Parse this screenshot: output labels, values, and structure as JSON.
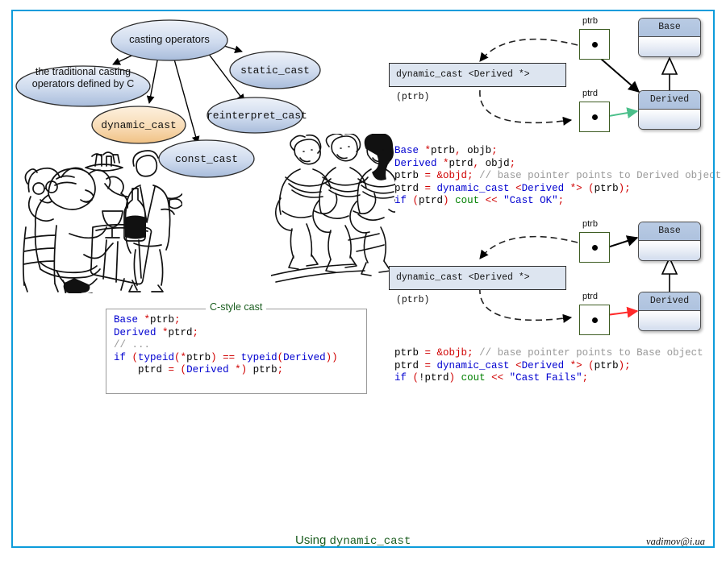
{
  "frame": {
    "border_color": "#0C9CDB"
  },
  "mindmap": {
    "nodes": [
      {
        "id": "root",
        "label": "casting operators",
        "fill": "blue"
      },
      {
        "id": "traditional",
        "label": "the traditional casting\noperators defined by C",
        "fill": "blue"
      },
      {
        "id": "static",
        "label": "static_cast",
        "fill": "blue"
      },
      {
        "id": "reinterpret",
        "label": "reinterpret_cast",
        "fill": "blue"
      },
      {
        "id": "dynamic",
        "label": "dynamic_cast",
        "fill": "orange"
      },
      {
        "id": "const",
        "label": "const_cast",
        "fill": "blue"
      }
    ],
    "edges": [
      {
        "from": "root",
        "to": "traditional"
      },
      {
        "from": "root",
        "to": "static"
      },
      {
        "from": "root",
        "to": "reinterpret"
      },
      {
        "from": "root",
        "to": "dynamic"
      },
      {
        "from": "root",
        "to": "const"
      }
    ],
    "colors": {
      "blue_fill_top": "#e7edf7",
      "blue_fill_bottom": "#aabedd",
      "orange_fill_top": "#fbe3c8",
      "orange_fill_bottom": "#f2c88c"
    }
  },
  "diagram_ok": {
    "expression": "dynamic_cast <Derived *> (ptrb)",
    "ptrb_label": "ptrb",
    "ptrd_label": "ptrd",
    "base_label": "Base",
    "derived_label": "Derived",
    "ptrd_arrow_color": "#4bbf8a",
    "result": "success"
  },
  "diagram_fail": {
    "expression": "dynamic_cast <Derived *> (ptrb)",
    "ptrb_label": "ptrb",
    "ptrd_label": "ptrd",
    "base_label": "Base",
    "derived_label": "Derived",
    "ptrd_arrow_color": "#ff2a2a",
    "result": "failure"
  },
  "code_ok": {
    "lines": [
      [
        {
          "t": "Base ",
          "c": "blue"
        },
        {
          "t": "*",
          "c": "red"
        },
        {
          "t": "ptrb",
          "c": "black"
        },
        {
          "t": ",",
          "c": "red"
        },
        {
          "t": " objb",
          "c": "black"
        },
        {
          "t": ";",
          "c": "red"
        }
      ],
      [
        {
          "t": "Derived ",
          "c": "blue"
        },
        {
          "t": "*",
          "c": "red"
        },
        {
          "t": "ptrd",
          "c": "black"
        },
        {
          "t": ",",
          "c": "red"
        },
        {
          "t": " objd",
          "c": "black"
        },
        {
          "t": ";",
          "c": "red"
        }
      ],
      [
        {
          "t": "ptrb ",
          "c": "black"
        },
        {
          "t": "=",
          "c": "red"
        },
        {
          "t": " ",
          "c": "black"
        },
        {
          "t": "&objd",
          "c": "red"
        },
        {
          "t": ";",
          "c": "red"
        },
        {
          "t": " // base pointer points to Derived object",
          "c": "gray"
        }
      ],
      [
        {
          "t": "ptrd ",
          "c": "black"
        },
        {
          "t": "=",
          "c": "red"
        },
        {
          "t": " dynamic_cast ",
          "c": "blue"
        },
        {
          "t": "<",
          "c": "red"
        },
        {
          "t": "Derived ",
          "c": "blue"
        },
        {
          "t": "*>",
          "c": "red"
        },
        {
          "t": " ",
          "c": "black"
        },
        {
          "t": "(",
          "c": "red"
        },
        {
          "t": "ptrb",
          "c": "black"
        },
        {
          "t": ")",
          "c": "red"
        },
        {
          "t": ";",
          "c": "red"
        }
      ],
      [
        {
          "t": "if ",
          "c": "blue"
        },
        {
          "t": "(",
          "c": "red"
        },
        {
          "t": "ptrd",
          "c": "black"
        },
        {
          "t": ")",
          "c": "red"
        },
        {
          "t": " cout ",
          "c": "green"
        },
        {
          "t": "<<",
          "c": "red"
        },
        {
          "t": " ",
          "c": "black"
        },
        {
          "t": "\"Cast OK\"",
          "c": "str"
        },
        {
          "t": ";",
          "c": "red"
        }
      ]
    ]
  },
  "code_fail": {
    "lines": [
      [
        {
          "t": "ptrb ",
          "c": "black"
        },
        {
          "t": "=",
          "c": "red"
        },
        {
          "t": " ",
          "c": "black"
        },
        {
          "t": "&objb",
          "c": "red"
        },
        {
          "t": ";",
          "c": "red"
        },
        {
          "t": " // base pointer points to Base object",
          "c": "gray"
        }
      ],
      [
        {
          "t": "ptrd ",
          "c": "black"
        },
        {
          "t": "=",
          "c": "red"
        },
        {
          "t": " dynamic_cast ",
          "c": "blue"
        },
        {
          "t": "<",
          "c": "red"
        },
        {
          "t": "Derived ",
          "c": "blue"
        },
        {
          "t": "*>",
          "c": "red"
        },
        {
          "t": " ",
          "c": "black"
        },
        {
          "t": "(",
          "c": "red"
        },
        {
          "t": "ptrb",
          "c": "black"
        },
        {
          "t": ")",
          "c": "red"
        },
        {
          "t": ";",
          "c": "red"
        }
      ],
      [
        {
          "t": "if ",
          "c": "blue"
        },
        {
          "t": "(",
          "c": "red"
        },
        {
          "t": "!ptrd",
          "c": "black"
        },
        {
          "t": ")",
          "c": "red"
        },
        {
          "t": " cout ",
          "c": "green"
        },
        {
          "t": "<<",
          "c": "red"
        },
        {
          "t": " ",
          "c": "black"
        },
        {
          "t": "\"Cast Fails\"",
          "c": "str"
        },
        {
          "t": ";",
          "c": "red"
        }
      ]
    ]
  },
  "cstyle": {
    "title": "C-style cast",
    "title_color": "#1b5e20",
    "lines": [
      [
        {
          "t": "Base ",
          "c": "blue"
        },
        {
          "t": "*",
          "c": "red"
        },
        {
          "t": "ptrb",
          "c": "black"
        },
        {
          "t": ";",
          "c": "red"
        }
      ],
      [
        {
          "t": "Derived ",
          "c": "blue"
        },
        {
          "t": "*",
          "c": "red"
        },
        {
          "t": "ptrd",
          "c": "black"
        },
        {
          "t": ";",
          "c": "red"
        }
      ],
      [
        {
          "t": "// ...",
          "c": "gray"
        }
      ],
      [
        {
          "t": "if ",
          "c": "blue"
        },
        {
          "t": "(",
          "c": "red"
        },
        {
          "t": "typeid",
          "c": "blue"
        },
        {
          "t": "(*",
          "c": "red"
        },
        {
          "t": "ptrb",
          "c": "black"
        },
        {
          "t": ") ",
          "c": "red"
        },
        {
          "t": "==",
          "c": "red"
        },
        {
          "t": " ",
          "c": "black"
        },
        {
          "t": "typeid",
          "c": "blue"
        },
        {
          "t": "(",
          "c": "red"
        },
        {
          "t": "Derived",
          "c": "blue"
        },
        {
          "t": "))",
          "c": "red"
        }
      ],
      [
        {
          "t": "    ptrd ",
          "c": "black"
        },
        {
          "t": "=",
          "c": "red"
        },
        {
          "t": " ",
          "c": "black"
        },
        {
          "t": "(",
          "c": "red"
        },
        {
          "t": "Derived ",
          "c": "blue"
        },
        {
          "t": "*)",
          "c": "red"
        },
        {
          "t": " ptrb",
          "c": "black"
        },
        {
          "t": ";",
          "c": "red"
        }
      ]
    ]
  },
  "cartoons": [
    {
      "id": "diners",
      "alt": "line-art cartoon of people dining at a restaurant table with a waiter"
    },
    {
      "id": "dancers",
      "alt": "line-art cartoon of three chorus-line dancers kicking"
    }
  ],
  "footer": {
    "caption_prefix": "Using ",
    "caption_mono": "dynamic_cast",
    "signature": "vadimov@i.ua"
  }
}
